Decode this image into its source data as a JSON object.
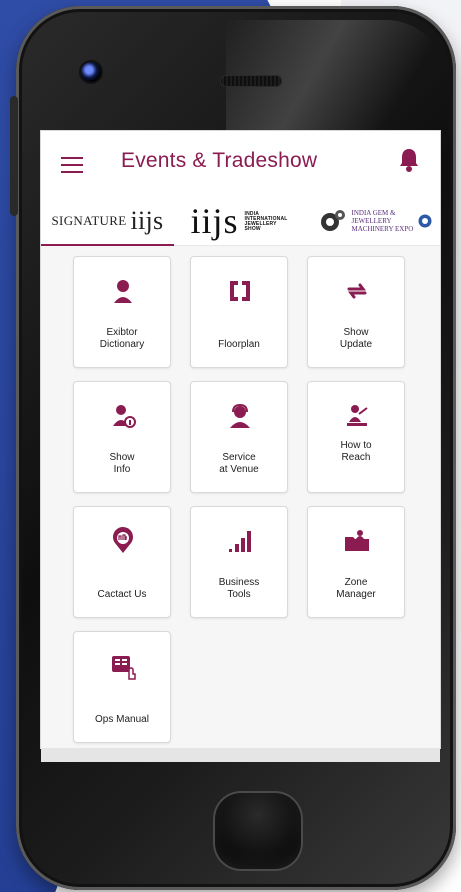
{
  "app": {
    "title": "Events & Tradeshow"
  },
  "colors": {
    "accent": "#8a1c51",
    "screen_bg": "#f6f6f6",
    "backdrop_blue": "#2f4ca6"
  },
  "header": {
    "menu_icon": "hamburger-menu-icon",
    "notification_icon": "bell-icon"
  },
  "tabs": [
    {
      "label": "SIGNATURE",
      "mark": "iijs",
      "active": true
    },
    {
      "label": "iijs",
      "sub": "INDIA INTERNATIONAL JEWELLERY SHOW",
      "active": false
    },
    {
      "label": "INDIA GEM & JEWELLERY MACHINERY EXPO",
      "active": false
    }
  ],
  "grid": {
    "items": [
      {
        "label_line1": "Exibtor",
        "label_line2": "Dictionary",
        "icon": "person-icon"
      },
      {
        "label_line1": "Floorplan",
        "label_line2": "",
        "icon": "floorplan-icon"
      },
      {
        "label_line1": "Show",
        "label_line2": "Update",
        "icon": "refresh-icon"
      },
      {
        "label_line1": "Show",
        "label_line2": "Info",
        "icon": "info-person-icon"
      },
      {
        "label_line1": "Service",
        "label_line2": "at Venue",
        "icon": "headset-person-icon"
      },
      {
        "label_line1": "How to",
        "label_line2": "Reach",
        "icon": "presentation-icon"
      },
      {
        "label_line1": "Cactact Us",
        "label_line2": "",
        "icon": "location-pin-icon"
      },
      {
        "label_line1": "Business",
        "label_line2": "Tools",
        "icon": "bar-chart-icon"
      },
      {
        "label_line1": "Zone",
        "label_line2": "Manager",
        "icon": "folder-person-icon"
      },
      {
        "label_line1": "Ops Manual",
        "label_line2": "",
        "icon": "manual-touch-icon"
      }
    ]
  }
}
